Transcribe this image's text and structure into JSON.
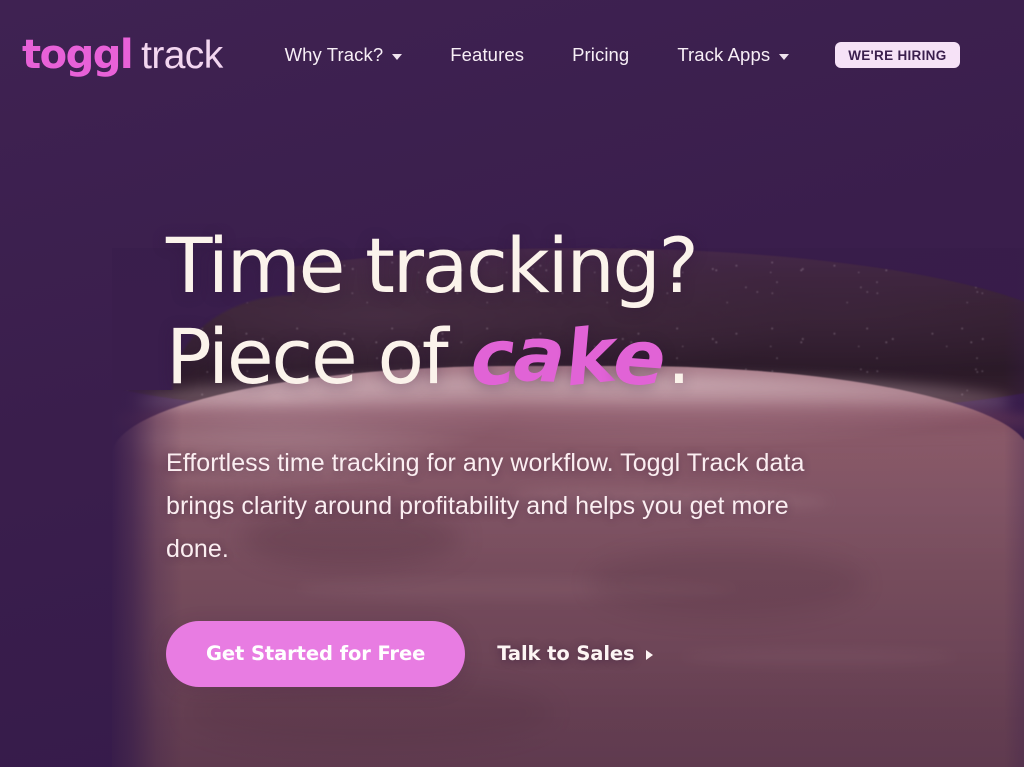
{
  "brand": {
    "logo_primary": "toggl",
    "logo_secondary": "track",
    "accent_pink": "#e163d6",
    "button_pink": "#e87ce2",
    "background_purple": "#3b1f4e",
    "cream": "#fbf3eb"
  },
  "nav": {
    "items": [
      {
        "label": "Why Track?",
        "has_dropdown": true,
        "icon": "chevron-down-icon"
      },
      {
        "label": "Features",
        "has_dropdown": false,
        "icon": ""
      },
      {
        "label": "Pricing",
        "has_dropdown": false,
        "icon": ""
      },
      {
        "label": "Track Apps",
        "has_dropdown": true,
        "icon": "chevron-down-icon"
      }
    ],
    "badge": "WE'RE HIRING"
  },
  "hero": {
    "title_line1": "Time tracking?",
    "title_line2_prefix": "Piece of ",
    "title_highlight": "cake",
    "title_highlight_letters": [
      "c",
      "a",
      "k",
      "e"
    ],
    "title_period": ".",
    "subtitle": "Effortless time tracking for any workflow. Toggl Track data brings clarity around profitability and helps you get more done.",
    "cta_primary": "Get Started for Free",
    "cta_secondary": "Talk to Sales",
    "cta_secondary_icon": "arrow-right-icon"
  }
}
